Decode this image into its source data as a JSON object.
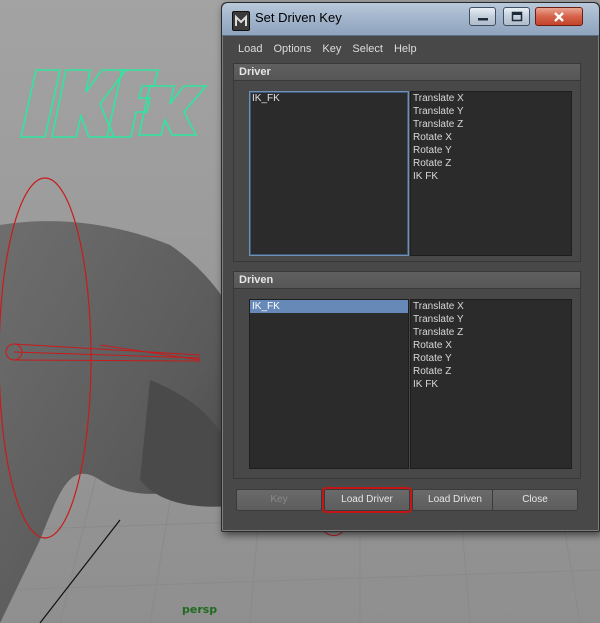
{
  "window": {
    "title": "Set Driven Key",
    "icons": {
      "app": "maya-app-icon",
      "minimize": "minimize-icon",
      "maximize": "maximize-icon",
      "close": "close-icon"
    }
  },
  "menu": [
    "Load",
    "Options",
    "Key",
    "Select",
    "Help"
  ],
  "driver": {
    "header": "Driver",
    "objects": [
      "IK_FK"
    ],
    "attributes": [
      "Translate X",
      "Translate Y",
      "Translate Z",
      "Rotate X",
      "Rotate Y",
      "Rotate Z",
      "IK FK"
    ]
  },
  "driven": {
    "header": "Driven",
    "objects": [
      "IK_FK"
    ],
    "attributes": [
      "Translate X",
      "Translate Y",
      "Translate Z",
      "Rotate X",
      "Rotate Y",
      "Rotate Z",
      "IK FK"
    ]
  },
  "buttons": {
    "key": "Key",
    "load_driver": "Load Driver",
    "load_driven": "Load Driven",
    "close": "Close"
  },
  "viewport": {
    "logo_text": "IK FK",
    "camera_label": "persp",
    "colors": {
      "background": "#9e9e9e",
      "logo": "#2fe6a0",
      "controller": "#cc1a1a",
      "highlight": "#c41616"
    }
  }
}
